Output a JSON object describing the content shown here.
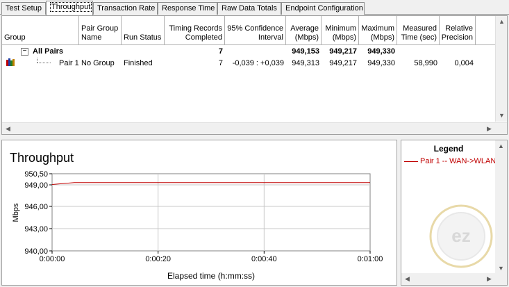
{
  "tabs": [
    {
      "label": "Test Setup",
      "active": false
    },
    {
      "label": "Throughput",
      "active": true
    },
    {
      "label": "Transaction Rate",
      "active": false
    },
    {
      "label": "Response Time",
      "active": false
    },
    {
      "label": "Raw Data Totals",
      "active": false
    },
    {
      "label": "Endpoint Configuration",
      "active": false
    }
  ],
  "table": {
    "headers": [
      "Group",
      "Pair Group Name",
      "Run Status",
      "Timing Records Completed",
      "95% Confidence Interval",
      "Average (Mbps)",
      "Minimum (Mbps)",
      "Maximum (Mbps)",
      "Measured Time (sec)",
      "Relative Precision"
    ],
    "group_row": {
      "expander": "−",
      "label": "All Pairs",
      "records": "7",
      "average": "949,153",
      "minimum": "949,217",
      "maximum": "949,330"
    },
    "pair_row": {
      "label": "Pair 1",
      "group_name": "No Group",
      "status": "Finished",
      "records": "7",
      "confidence": "-0,039 : +0,039",
      "average": "949,313",
      "minimum": "949,217",
      "maximum": "949,330",
      "measured_time": "58,990",
      "precision": "0,004"
    }
  },
  "chart_data": {
    "type": "line",
    "title": "Throughput",
    "xlabel": "Elapsed time (h:mm:ss)",
    "ylabel": "Mbps",
    "y_ticks": [
      "950,50",
      "949,00",
      "946,00",
      "943,00",
      "940,00"
    ],
    "y_tick_values": [
      950.5,
      949.0,
      946.0,
      943.0,
      940.0
    ],
    "x_ticks": [
      "0:00:00",
      "0:00:20",
      "0:00:40",
      "0:01:00"
    ],
    "x_tick_values": [
      0,
      20,
      40,
      60
    ],
    "xlim": [
      0,
      60
    ],
    "ylim": [
      940.0,
      950.5
    ],
    "series": [
      {
        "name": "Pair 1 -- WAN->WLAN",
        "color": "#c00000",
        "x": [
          0,
          4.2,
          10,
          20,
          30,
          40,
          50,
          60
        ],
        "y": [
          949.05,
          949.3,
          949.3,
          949.3,
          949.3,
          949.3,
          949.3,
          949.3
        ]
      }
    ],
    "grid": true
  },
  "legend": {
    "title": "Legend",
    "items": [
      "Pair 1 -- WAN->WLAN"
    ]
  },
  "watermark": {
    "text": "GLOBAL EASY www.geeid.com"
  }
}
